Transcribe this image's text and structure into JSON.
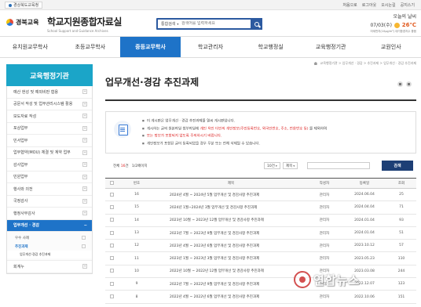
{
  "topbar": {
    "org": "경상북도교육청",
    "links": [
      "처음으로",
      "로그아웃",
      "오시는길",
      "공지스기"
    ]
  },
  "header": {
    "office_name": "경북교육",
    "site_title": "학교지원종합자료실",
    "site_subtitle": "School Support and Guidance Archives",
    "search": {
      "category": "통합검색",
      "placeholder": "검색어를 입력하세요"
    },
    "weather": {
      "label": "오늘의 날씨",
      "date": "07/03(수)",
      "temp": "26℃",
      "dust": "미세먼지(10μg/m³) 대기환경지수 좋음"
    }
  },
  "nav": {
    "items": [
      "유치원교무학사",
      "초등교무학사",
      "중등교무학사",
      "학교관리자",
      "학교행정실",
      "교육행정기관",
      "교원인사"
    ],
    "active_index": 2
  },
  "sidebar": {
    "title": "교육행정기관",
    "items": [
      "예산 현성 및 예외비판 협용",
      "공문서 작성 및 업무관리시스템 활용",
      "보도자료 작성",
      "포상업무",
      "민서업무",
      "업무협약(MOU) 체결 및 계약 업무",
      "감사업무",
      "민원업무",
      "행사와 의전",
      "국정감사",
      "행정사무감사",
      "업무개선 · 경감"
    ],
    "active_label": "업무개선 · 경감",
    "sub_items": [
      "우수 사례",
      "추진과제"
    ],
    "current_sub": "추진과제",
    "sub2": "업무개선·경감 추진과제",
    "last_item": "회계누"
  },
  "content": {
    "breadcrumb": [
      "교육행정기관",
      "업무개선 · 경감",
      "추진과제",
      "업무개선 · 경감 추진과제"
    ],
    "title": "업무개선·경감 추진과제",
    "notice": {
      "line1": "이 게시판은 업무개선 · 경감 추진과제를 열씨 게시판입니다.",
      "line2a": "게시하는 글의 원본파일 첨부파일에",
      "line2b": "개인 욕인 다인의 개인정보(주민등록번호, 외국인번호, 주소, 전화번호 등)",
      "line2c": "를 제외하여",
      "line3": "또는 정보가 포함되지 않도록 주의하시기 바랍니다.",
      "line4": "개인정보가 포함된 글이 등록되었을 경우 무분 또는 전체 삭제될 수 있습니다."
    },
    "list": {
      "total_label": "전체",
      "total": "16",
      "total_unit": "건",
      "page": "1/2페이지",
      "per_page": "10건",
      "search_field": "제목",
      "search_button": "검색"
    },
    "table": {
      "headers": [
        "",
        "번호",
        "제목",
        "작성자",
        "등록일",
        "조회"
      ],
      "rows": [
        [
          "16",
          "2024년 4월 ~ 2024년 5월 업무개선 및 경감사항 추진과제",
          "관리자",
          "2024.06.04",
          "25"
        ],
        [
          "15",
          "2024년 1월~2024년 3월 업무개선 및 경감사항 추진과제",
          "관리자",
          "2024.04.04",
          "71"
        ],
        [
          "14",
          "2023년 10월 ~ 2023년 12월 업무개선 및 경감사항 추진과제",
          "관리자",
          "2024.01.04",
          "93"
        ],
        [
          "13",
          "2023년 7월 ~ 2023년 9월 업무개선 및 경감사항 추진과제",
          "관리자",
          "2024.01.04",
          "51"
        ],
        [
          "12",
          "2023년 4월 ~ 2023년 6월 업무개선 및 경감사항 추진과제",
          "관리자",
          "2023.10.12",
          "57"
        ],
        [
          "11",
          "2023년 1월 ~ 2023년 3월 업무개선 및 경감사항 추진과제",
          "관리자",
          "2023.05.23",
          "110"
        ],
        [
          "10",
          "2022년 10월 ~ 2022년 12월 업무개선 및 경감사항 추진과제",
          "관리자",
          "2023.03.08",
          "244"
        ],
        [
          "9",
          "2022년 7월 ~ 2022년 9월 업무개선 및 경감사항 추진과제",
          "관리자",
          "2022.12.07",
          "123"
        ],
        [
          "8",
          "2022년 4월 ~ 2022년 6월 업무개선 및 경감사항 추진과제",
          "관리자",
          "2022.10.06",
          "151"
        ],
        [
          "7",
          "2022년 1월 ~ 2022년 3월 업무개선 및 경감사항 추진과제",
          "관리자",
          "2022.03.08",
          "234"
        ]
      ]
    }
  },
  "watermark": "연합뉴스"
}
